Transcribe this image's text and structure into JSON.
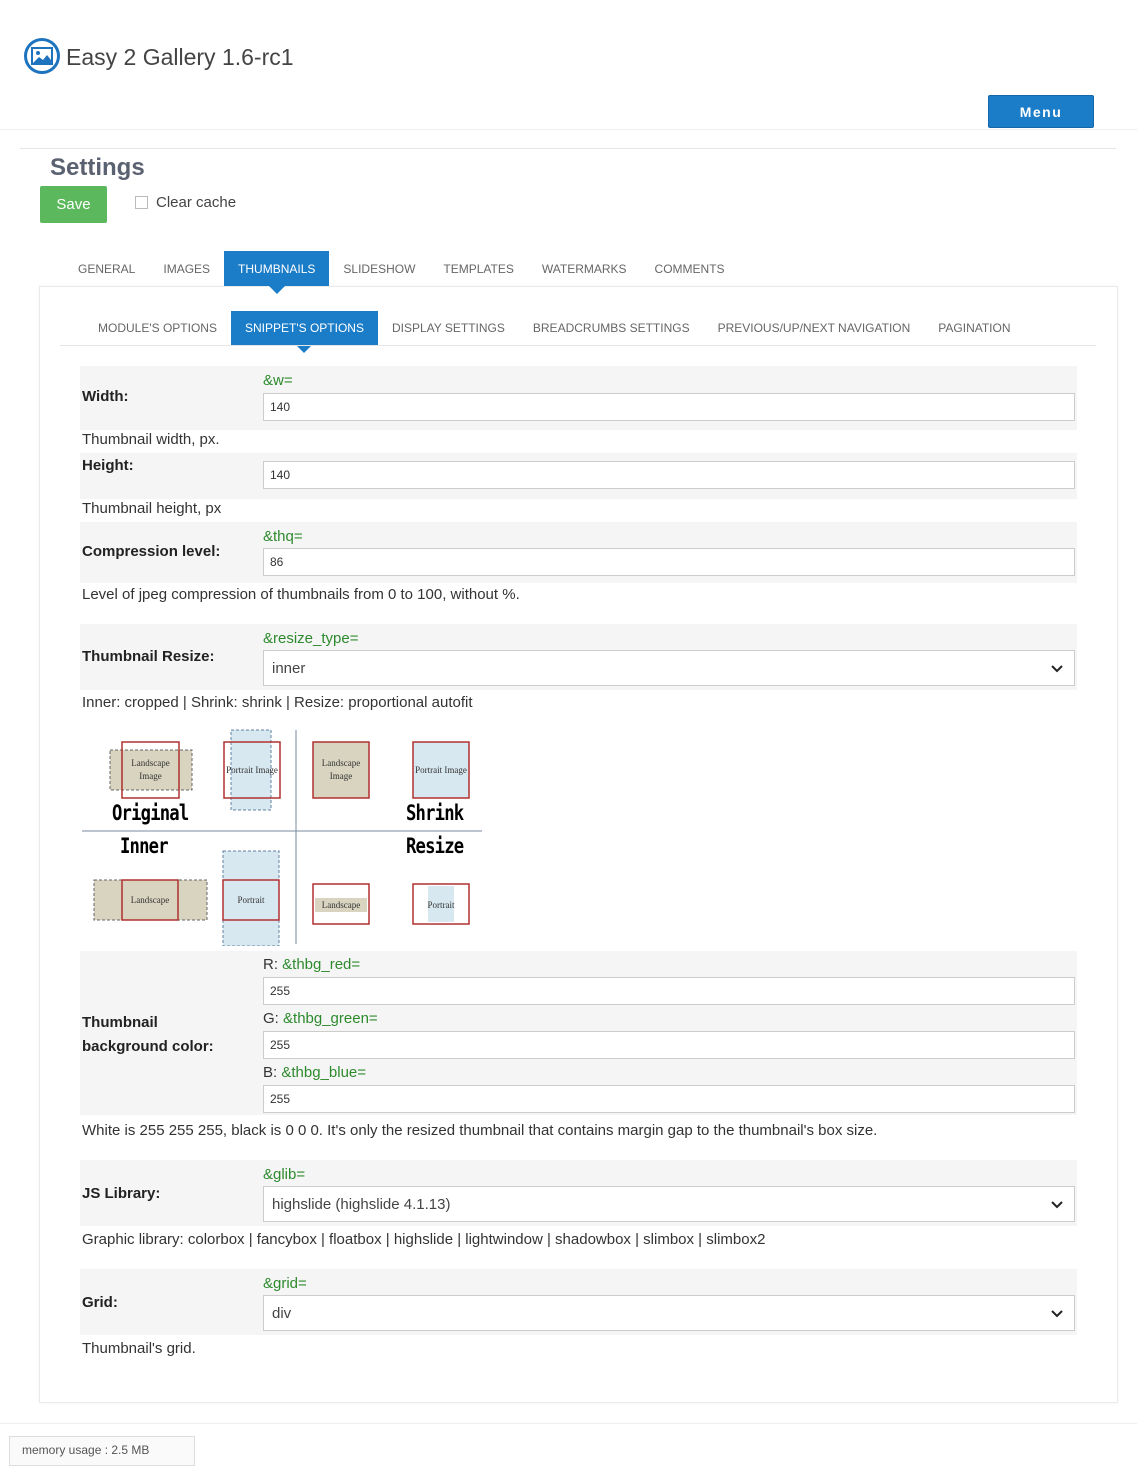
{
  "app": {
    "title": "Easy 2 Gallery 1.6-rc1",
    "logo_icon": "image-icon",
    "menu_label": "Menu"
  },
  "page": {
    "title": "Settings",
    "save_label": "Save",
    "clear_cache_label": "Clear cache"
  },
  "tabs": [
    "GENERAL",
    "IMAGES",
    "THUMBNAILS",
    "SLIDESHOW",
    "TEMPLATES",
    "WATERMARKS",
    "COMMENTS"
  ],
  "active_tab": "THUMBNAILS",
  "subtabs": [
    "MODULE'S OPTIONS",
    "SNIPPET'S OPTIONS",
    "DISPLAY SETTINGS",
    "BREADCRUMBS SETTINGS",
    "PREVIOUS/UP/NEXT NAVIGATION",
    "PAGINATION"
  ],
  "active_subtab": "SNIPPET'S OPTIONS",
  "fields": {
    "width": {
      "label": "Width:",
      "param": "&w=",
      "value": "140",
      "desc": "Thumbnail width, px."
    },
    "height": {
      "label": "Height:",
      "value": "140",
      "desc": "Thumbnail height, px"
    },
    "compression": {
      "label": "Compression level:",
      "param": "&thq=",
      "value": "86",
      "desc": "Level of jpeg compression of thumbnails from 0 to 100, without %."
    },
    "resize": {
      "label": "Thumbnail Resize:",
      "param": "&resize_type=",
      "value": "inner",
      "desc": "Inner: cropped | Shrink: shrink | Resize: proportional autofit"
    },
    "bgcolor": {
      "label_line1": "Thumbnail",
      "label_line2": "background color:",
      "red_prefix": "R:",
      "red_param": "&thbg_red=",
      "red_value": "255",
      "green_prefix": "G:",
      "green_param": "&thbg_green=",
      "green_value": "255",
      "blue_prefix": "B:",
      "blue_param": "&thbg_blue=",
      "blue_value": "255",
      "desc": "White is 255 255 255, black is 0 0 0. It's only the resized thumbnail that contains margin gap to the thumbnail's box size."
    },
    "jslib": {
      "label": "JS Library:",
      "param": "&glib=",
      "value": "highslide (highslide 4.1.13)",
      "desc": "Graphic library: colorbox | fancybox | floatbox | highslide | lightwindow | shadowbox | slimbox | slimbox2"
    },
    "grid": {
      "label": "Grid:",
      "param": "&grid=",
      "value": "div",
      "desc": "Thumbnail's grid."
    }
  },
  "diagram": {
    "original": "Original",
    "shrink": "Shrink",
    "inner": "Inner",
    "resize": "Resize",
    "landscape_image": "Landscape Image",
    "portrait_image": "Portrait Image",
    "landscape": "Landscape",
    "portrait": "Portrait"
  },
  "footer": {
    "memory": "memory usage : 2.5 MB"
  },
  "colors": {
    "accent": "#1b7cc8",
    "save": "#5cb85c",
    "param": "#2d8a2d"
  }
}
